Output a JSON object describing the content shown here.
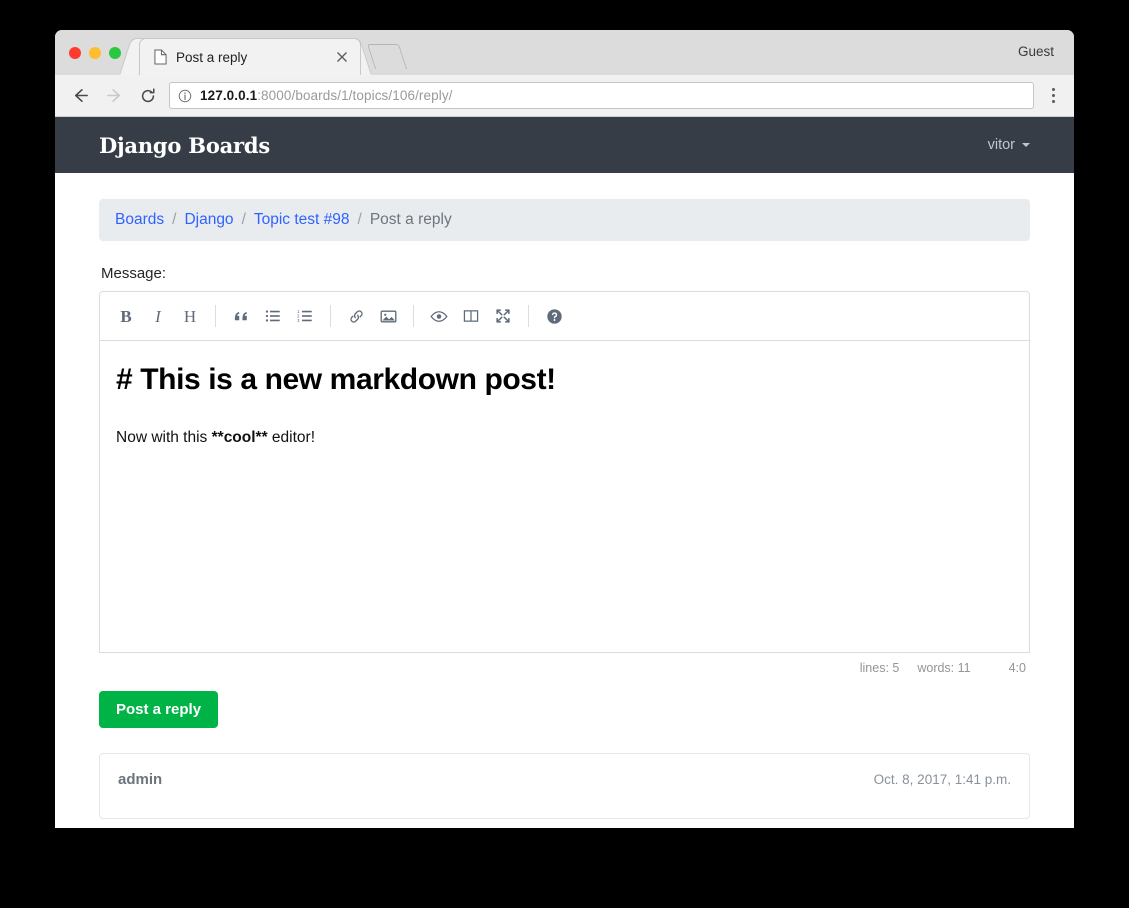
{
  "browser": {
    "tab": {
      "title": "Post a reply",
      "favicon_icon": "page-icon",
      "close_icon": "close-icon"
    },
    "new_tab_icon": "new-tab-button",
    "profile_label": "Guest",
    "nav": {
      "back_icon": "back-arrow-icon",
      "forward_icon": "forward-arrow-icon",
      "reload_icon": "reload-icon",
      "menu_icon": "kebab-menu-icon"
    },
    "omnibox": {
      "info_icon": "info-circle-icon",
      "url_host": "127.0.0.1",
      "url_rest": ":8000/boards/1/topics/106/reply/",
      "url_full": "127.0.0.1:8000/boards/1/topics/106/reply/"
    }
  },
  "navbar": {
    "brand": "Django Boards",
    "user": "vitor",
    "caret_icon": "chevron-down-icon",
    "background": "#373d47"
  },
  "breadcrumb": {
    "items": [
      {
        "label": "Boards",
        "link": true
      },
      {
        "label": "Django",
        "link": true
      },
      {
        "label": "Topic test #98",
        "link": true
      },
      {
        "label": "Post a reply",
        "link": false
      }
    ],
    "separator": "/",
    "link_color": "#2f63ff",
    "background": "#e9ecef"
  },
  "form": {
    "message_label": "Message:",
    "submit_label": "Post a reply",
    "submit_color": "#00b347"
  },
  "editor": {
    "toolbar": [
      {
        "name": "bold-icon",
        "glyph": "B",
        "kind": "letter-bold",
        "title": "Bold"
      },
      {
        "name": "italic-icon",
        "glyph": "I",
        "kind": "letter-italic",
        "title": "Italic"
      },
      {
        "name": "heading-icon",
        "glyph": "H",
        "kind": "letter",
        "title": "Heading"
      },
      {
        "name": "separator",
        "kind": "sep"
      },
      {
        "name": "quote-icon",
        "glyph": "“",
        "kind": "quote",
        "title": "Quote"
      },
      {
        "name": "unordered-list-icon",
        "kind": "ul",
        "title": "Generic List"
      },
      {
        "name": "ordered-list-icon",
        "kind": "ol",
        "title": "Numbered List"
      },
      {
        "name": "separator",
        "kind": "sep"
      },
      {
        "name": "link-icon",
        "kind": "link",
        "title": "Create Link"
      },
      {
        "name": "image-icon",
        "kind": "image",
        "title": "Insert Image"
      },
      {
        "name": "separator",
        "kind": "sep"
      },
      {
        "name": "preview-eye-icon",
        "kind": "eye",
        "title": "Toggle Preview"
      },
      {
        "name": "side-by-side-icon",
        "kind": "columns",
        "title": "Toggle Side by Side"
      },
      {
        "name": "fullscreen-icon",
        "kind": "fullscreen",
        "title": "Toggle Fullscreen"
      },
      {
        "name": "separator",
        "kind": "sep"
      },
      {
        "name": "help-icon",
        "kind": "question",
        "title": "Markdown Guide"
      }
    ],
    "content": {
      "heading_line": "# This is a new markdown post!",
      "paragraph_prefix": "Now with this ",
      "paragraph_bold": "**cool**",
      "paragraph_suffix": " editor!"
    },
    "statusbar": {
      "lines": "lines: 5",
      "words": "words: 11",
      "cursor": "4:0"
    }
  },
  "post": {
    "author": "admin",
    "date": "Oct. 8, 2017, 1:41 p.m."
  }
}
